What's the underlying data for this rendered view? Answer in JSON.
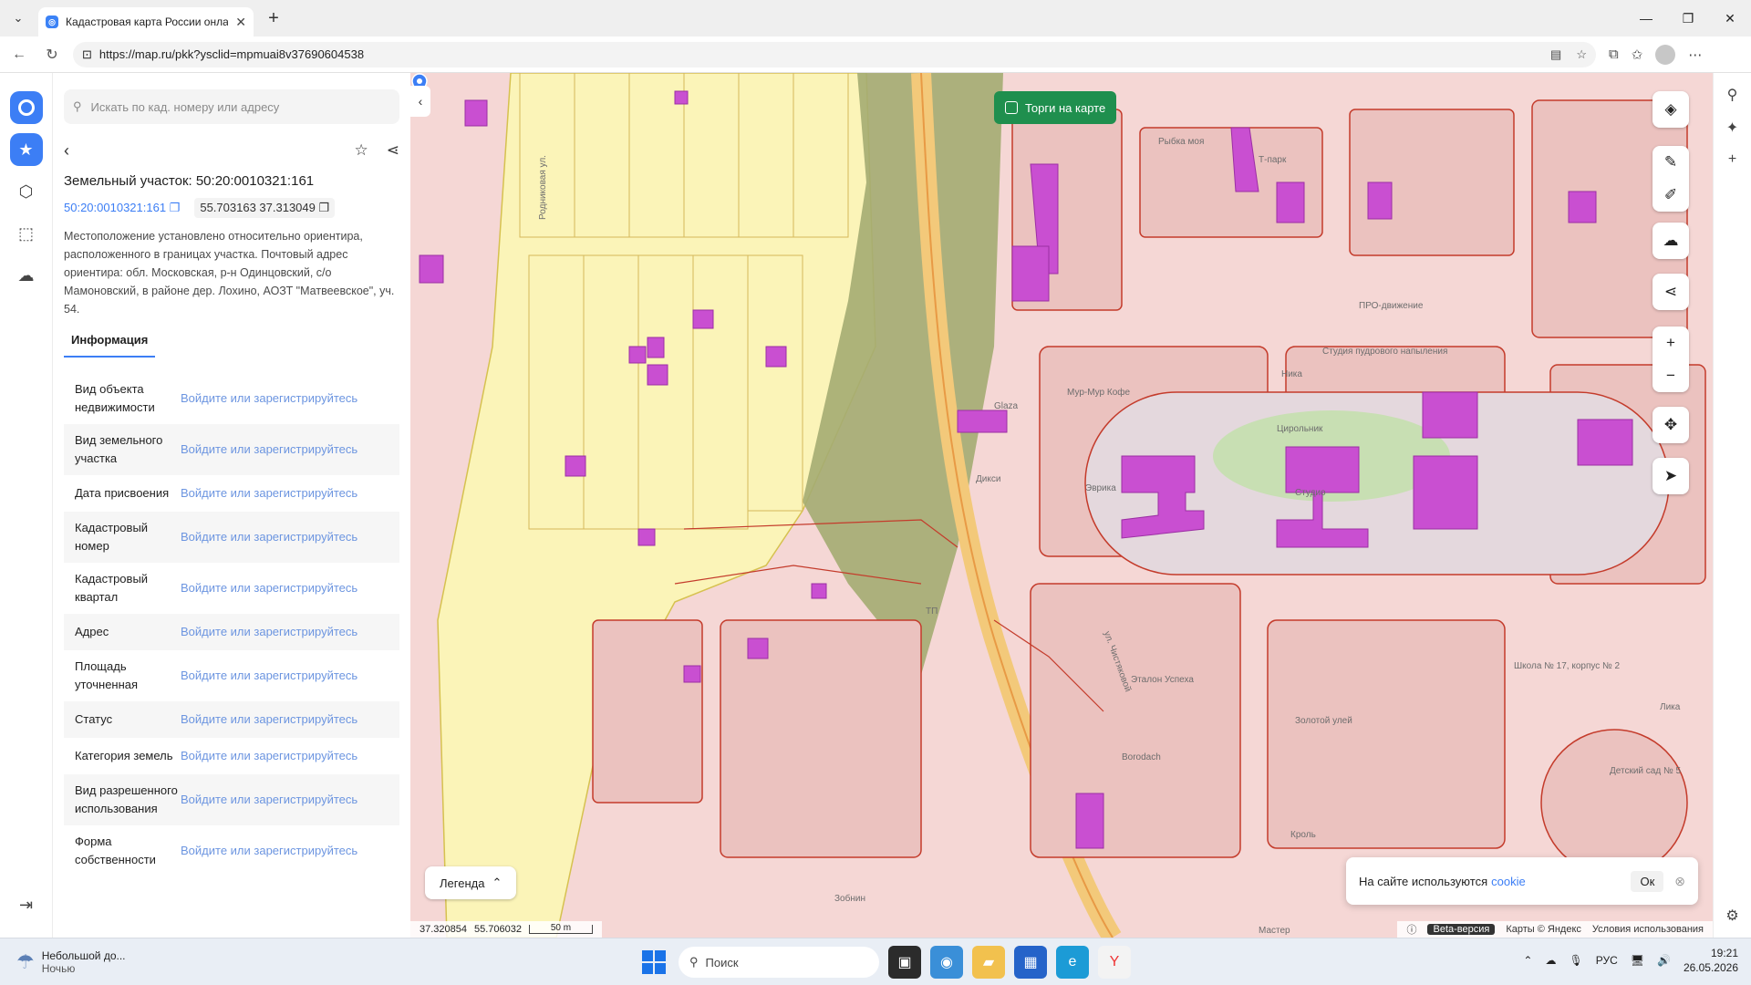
{
  "browser": {
    "tab_title": "Кадастровая карта России онлайн",
    "tab_close": "✕",
    "new_tab": "+",
    "url": "https://map.ru/pkk?ysclid=mpmuai8v37690604538",
    "win_min": "—",
    "win_max": "❐",
    "win_close": "✕"
  },
  "panel": {
    "search_placeholder": "Искать по кад. номеру или адресу",
    "title": "Земельный участок: 50:20:0010321:161",
    "cad_number": "50:20:0010321:161",
    "coords": "55.703163 37.313049",
    "description": "Местоположение установлено относительно ориентира, расположенного в границах участка. Почтовый адрес ориентира: обл. Московская, р-н Одинцовский, с/о Мамоновский, в районе дер. Лохино, АОЗТ \"Матвеевское\", уч. 54.",
    "tab_info": "Информация",
    "rows": [
      {
        "label": "Вид объекта недвижимости",
        "value": "Войдите или зарегистрируйтесь"
      },
      {
        "label": "Вид земельного участка",
        "value": "Войдите или зарегистрируйтесь"
      },
      {
        "label": "Дата присвоения",
        "value": "Войдите или зарегистрируйтесь"
      },
      {
        "label": "Кадастровый номер",
        "value": "Войдите или зарегистрируйтесь"
      },
      {
        "label": "Кадастровый квартал",
        "value": "Войдите или зарегистрируйтесь"
      },
      {
        "label": "Адрес",
        "value": "Войдите или зарегистрируйтесь"
      },
      {
        "label": "Площадь уточненная",
        "value": "Войдите или зарегистрируйтесь"
      },
      {
        "label": "Статус",
        "value": "Войдите или зарегистрируйтесь"
      },
      {
        "label": "Категория земель",
        "value": "Войдите или зарегистрируйтесь"
      },
      {
        "label": "Вид разрешенного использования",
        "value": "Войдите или зарегистрируйтесь"
      },
      {
        "label": "Форма собственности",
        "value": "Войдите или зарегистрируйтесь"
      }
    ]
  },
  "map": {
    "torgi_label": "Торги на карте",
    "legend_label": "Легенда",
    "coord_x": "37.320854",
    "coord_y": "55.706032",
    "scale_label": "50 m",
    "beta_label": "Beta-версия",
    "attribution": "Карты © Яндекс",
    "terms": "Условия использования",
    "cookie_text": "На сайте используются",
    "cookie_link": "cookie",
    "cookie_ok": "Ок",
    "labels": {
      "street1": "Родниковая ул.",
      "street2": "ул. Чистяковой",
      "school": "Школа № 17, корпус № 2",
      "kinder": "Детский сад № 5",
      "dixi": "Дикси",
      "glaza": "Glaza",
      "myrmyr": "Мур-Мур Кофе",
      "evrika": "Эврика",
      "nika": "Ника",
      "tsirol": "Цирольник",
      "studio": "Студия пудрового напыления",
      "studio2": "Студио",
      "etalon": "Эталон Успеха",
      "zolotoi": "Золотой улей",
      "borodach": "Borodach",
      "zobnin": "Зобнин",
      "lika": "Лика",
      "prodvizhenie": "ПРО-движение",
      "master": "Мастер",
      "krol": "Кроль",
      "tp": "ТП",
      "rybka": "Рыбка моя",
      "tpark": "Т-парк"
    },
    "colors": {
      "pink_area": "#f5d7d5",
      "yellow_area": "#fbf4b8",
      "green_area": "#9fa86c",
      "building": "#c94fd1",
      "boundary": "#c43b2b",
      "accent": "#3c7ef5"
    }
  },
  "taskbar": {
    "weather_title": "Небольшой до...",
    "weather_sub": "Ночью",
    "search_label": "Поиск",
    "lang": "РУС",
    "time": "19:21",
    "date": "26.05.2026"
  }
}
